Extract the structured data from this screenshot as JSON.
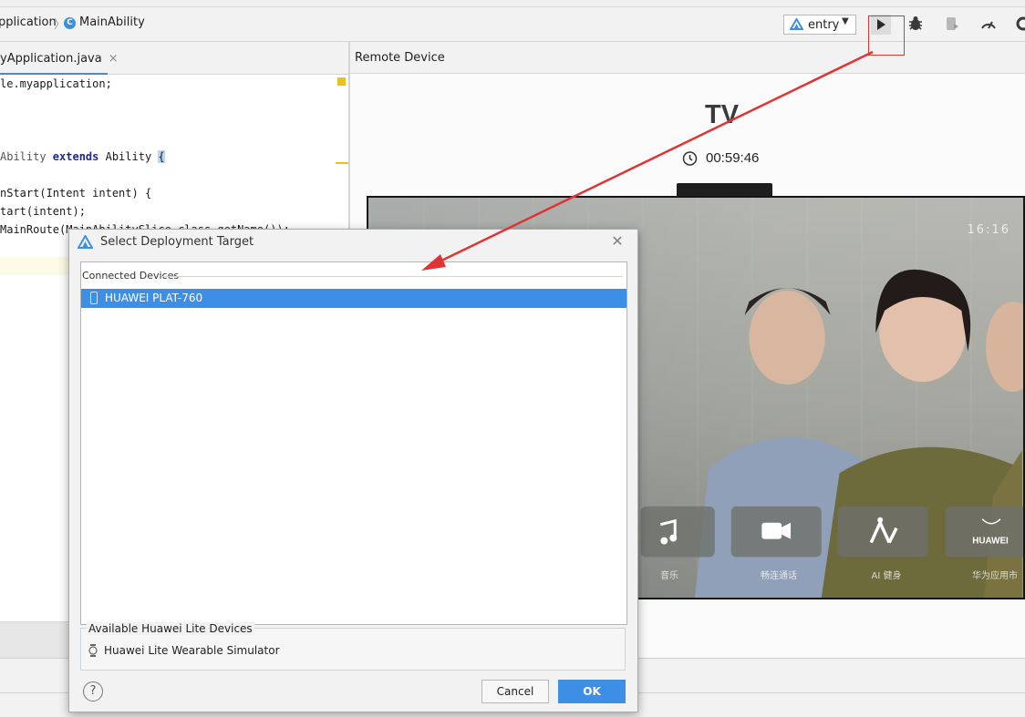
{
  "breadcrumb": {
    "segment1": "pplication",
    "segment2": "MainAbility",
    "class_badge": "C"
  },
  "toolbar": {
    "run_config": "entry",
    "icons": [
      "run-icon",
      "debug-icon",
      "attach-debugger-icon",
      "profiler-icon",
      "settings-icon"
    ]
  },
  "editor": {
    "tab_label": "yApplication.java",
    "tab_close": "×",
    "lines": [
      {
        "text": "le.myapplication;"
      },
      {
        "pre": "Ability ",
        "kw": "extends",
        "post": " Ability ",
        "brace": "{"
      },
      {
        "text": "nStart(Intent intent) {"
      },
      {
        "text": "tart(intent);"
      },
      {
        "text": "MainRoute(MainAbilitySlice.class.getName());"
      }
    ]
  },
  "remote": {
    "header": "Remote Device",
    "device_title": "TV",
    "timer": "00:59:46",
    "screen_time": "16:16",
    "tiles": [
      {
        "label": "音乐",
        "icon": "music-note-icon"
      },
      {
        "label": "畅连通话",
        "icon": "video-call-icon"
      },
      {
        "label": "AI 健身",
        "icon": "ai-fitness-icon"
      },
      {
        "label": "华为应用市",
        "icon": "huawei-appgallery-icon",
        "brand": "HUAWEI"
      }
    ]
  },
  "dialog": {
    "title": "Select Deployment Target",
    "connected_header": "Connected Devices",
    "devices": [
      {
        "name": "HUAWEI PLAT-760",
        "selected": true
      }
    ],
    "lite_header": "Available Huawei Lite Devices",
    "lite_devices": [
      {
        "name": "Huawei Lite Wearable Simulator"
      }
    ],
    "help": "?",
    "cancel": "Cancel",
    "ok": "OK"
  },
  "colors": {
    "accent": "#3d8fe5",
    "annotation": "#e03434"
  }
}
